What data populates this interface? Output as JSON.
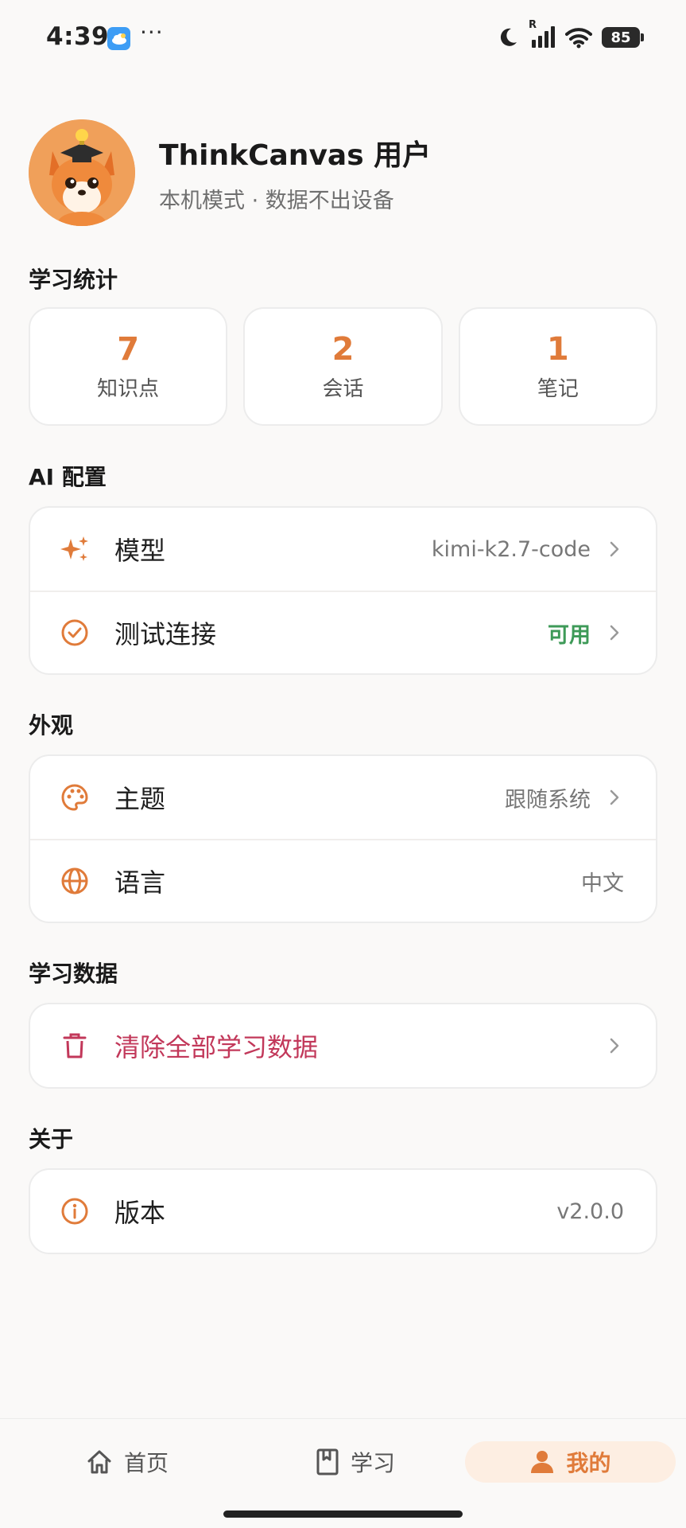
{
  "status_bar": {
    "time": "4:39",
    "dots": "···",
    "signal_label": "R",
    "battery": "85"
  },
  "profile": {
    "name": "ThinkCanvas 用户",
    "subtitle": "本机模式 · 数据不出设备"
  },
  "stats_section": {
    "title": "学习统计",
    "items": [
      {
        "value": "7",
        "label": "知识点"
      },
      {
        "value": "2",
        "label": "会话"
      },
      {
        "value": "1",
        "label": "笔记"
      }
    ]
  },
  "ai_section": {
    "title": "AI 配置",
    "model_label": "模型",
    "model_value": "kimi-k2.7-code",
    "test_label": "测试连接",
    "test_value": "可用"
  },
  "appearance_section": {
    "title": "外观",
    "theme_label": "主题",
    "theme_value": "跟随系统",
    "language_label": "语言",
    "language_value": "中文"
  },
  "data_section": {
    "title": "学习数据",
    "clear_label": "清除全部学习数据"
  },
  "about_section": {
    "title": "关于",
    "version_label": "版本",
    "version_value": "v2.0.0"
  },
  "bottom_nav": {
    "home": "首页",
    "study": "学习",
    "mine": "我的"
  },
  "colors": {
    "accent": "#e07b3a",
    "success": "#3e9a58",
    "danger": "#c2385a",
    "background": "#faf9f8"
  },
  "icons": {
    "weather": "weather-cloud-icon",
    "moon": "moon-icon",
    "signal": "signal-icon",
    "wifi": "wifi-icon",
    "model": "sparkles-icon",
    "test": "check-circle-icon",
    "theme": "palette-icon",
    "language": "globe-icon",
    "clear": "trash-icon",
    "version": "info-icon",
    "home": "home-icon",
    "study": "book-icon",
    "mine": "user-icon"
  }
}
